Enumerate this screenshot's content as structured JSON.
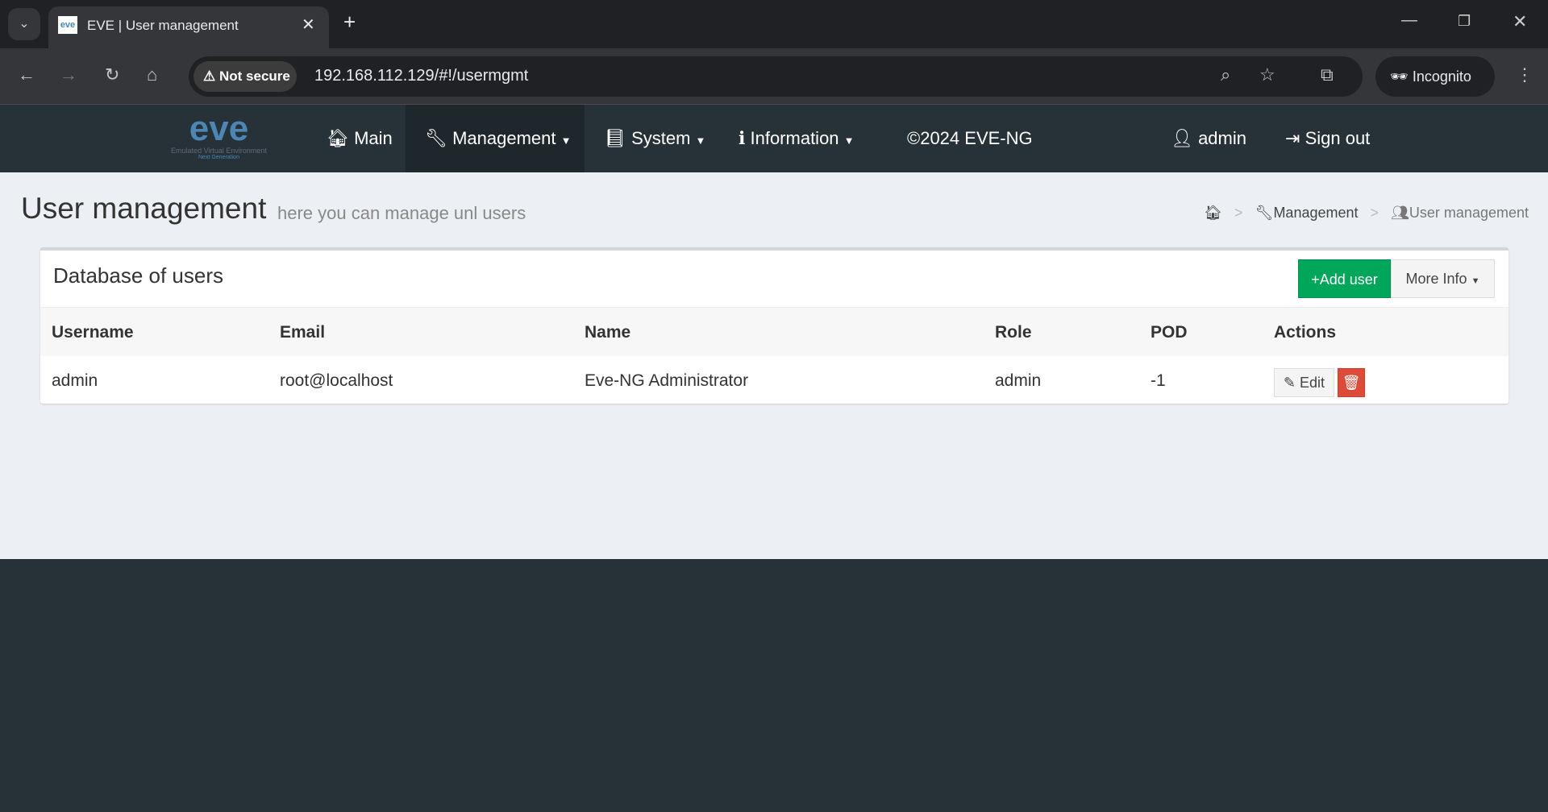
{
  "browser": {
    "tab_title": "EVE | User management",
    "url": "192.168.112.129/#!/usermgmt",
    "security_label": "Not secure",
    "profile_label": "Incognito"
  },
  "nav": {
    "logo_text": "eve",
    "logo_subtitle": "Emulated Virtual Environment",
    "logo_subtitle2": "Next Generation",
    "main": "Main",
    "management": "Management",
    "system": "System",
    "information": "Information",
    "copyright": "©2024 EVE-NG",
    "user": "admin",
    "signout": "Sign out"
  },
  "page": {
    "title": "User management",
    "subtitle": "here you can manage unl users",
    "breadcrumb": [
      "Management",
      "User management"
    ]
  },
  "box": {
    "title": "Database of users",
    "add_user": "+Add user",
    "more_info": "More Info"
  },
  "table": {
    "headers": [
      "Username",
      "Email",
      "Name",
      "Role",
      "POD",
      "Actions"
    ],
    "rows": [
      {
        "username": "admin",
        "email": "root@localhost",
        "name": "Eve-NG Administrator",
        "role": "admin",
        "pod": "-1",
        "edit": "Edit"
      }
    ]
  },
  "colors": {
    "nav_bg": "#263238",
    "content_bg": "#ecf0f5",
    "add_button": "#00a65a",
    "delete_button": "#dd4b39"
  }
}
